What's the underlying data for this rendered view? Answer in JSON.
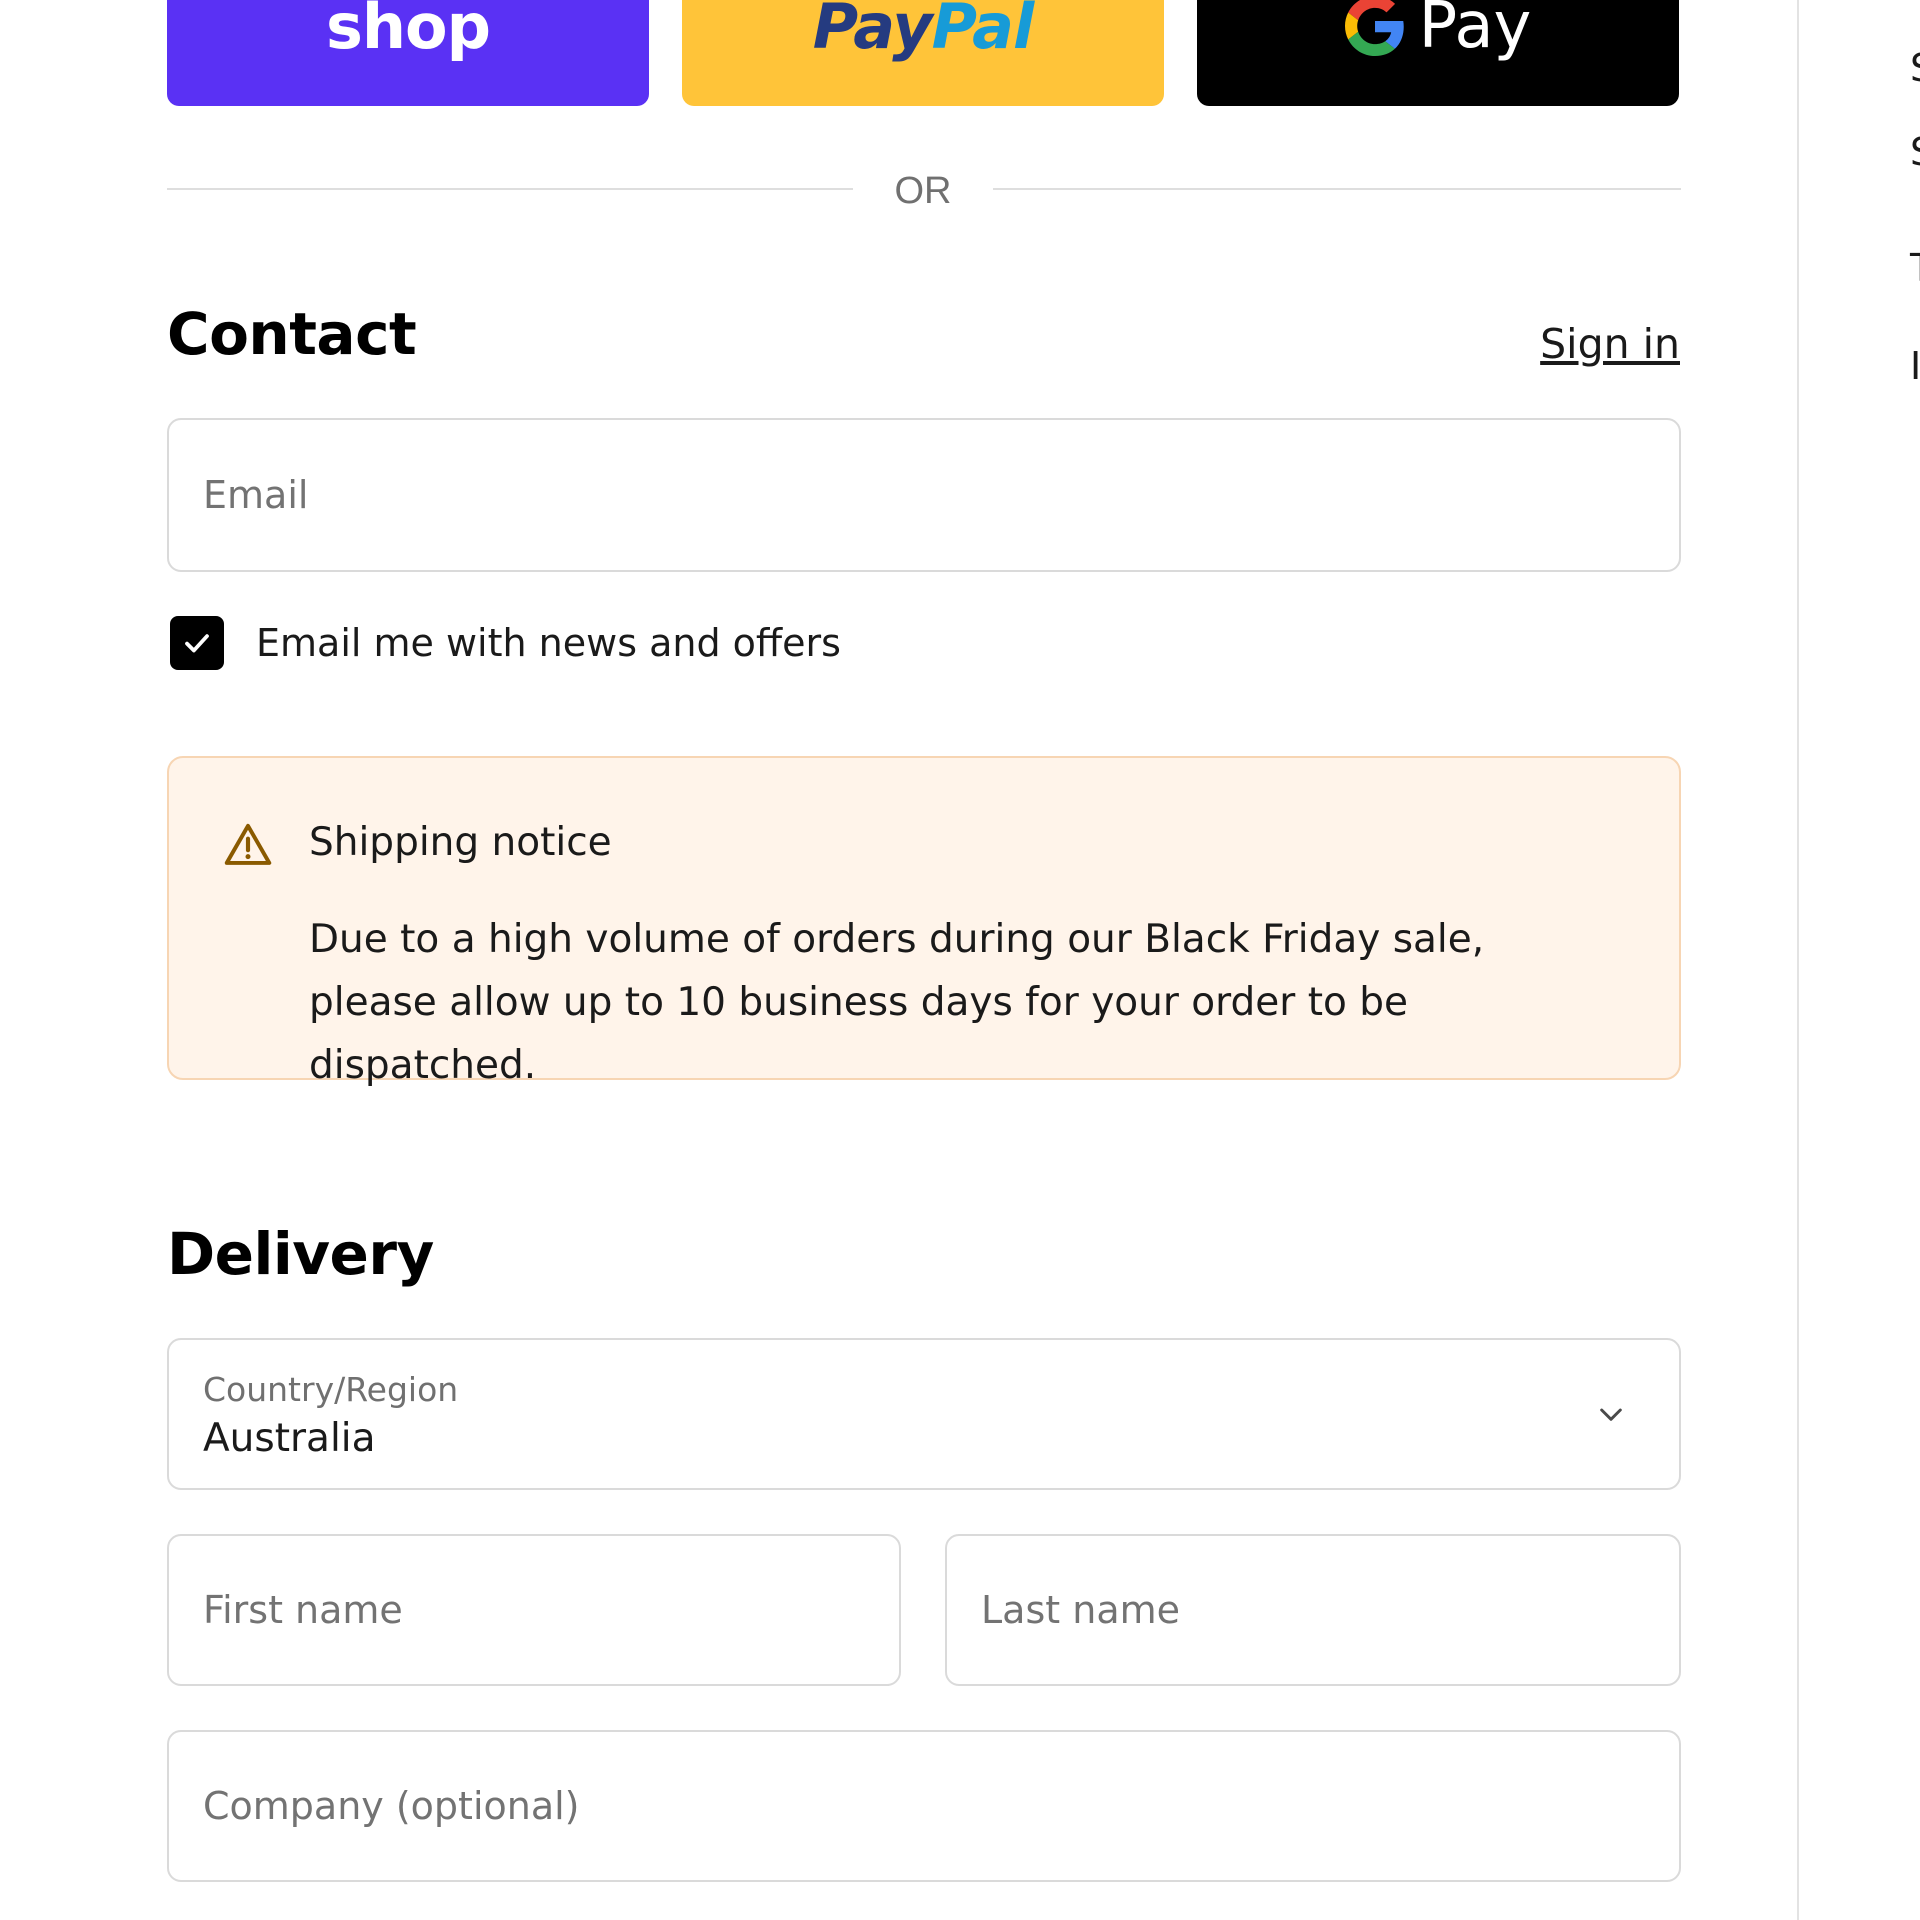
{
  "express_checkout": {
    "shop_label": "shop",
    "paypal_label_pay": "Pay",
    "paypal_label_pal": "Pal",
    "gpay_label": "Pay"
  },
  "divider": {
    "text": "OR"
  },
  "contact": {
    "title": "Contact",
    "sign_in": "Sign in",
    "email_placeholder": "Email",
    "email_value": "",
    "newsletter_label": "Email me with news and offers",
    "newsletter_checked": true
  },
  "notice": {
    "title": "Shipping notice",
    "body": "Due to a high volume of orders during our Black Friday sale, please allow up to 10 business days for your order to be dispatched."
  },
  "delivery": {
    "title": "Delivery",
    "country_label": "Country/Region",
    "country_value": "Australia",
    "first_name_placeholder": "First name",
    "last_name_placeholder": "Last name",
    "company_placeholder": "Company (optional)"
  },
  "colors": {
    "shop_purple": "#5a31f4",
    "paypal_yellow": "#ffc439",
    "gpay_black": "#000000",
    "notice_bg": "#fff4ea",
    "notice_border": "#f7d5b3",
    "warning_icon": "#8a5a00"
  },
  "icons": {
    "gpay": "google-g-icon",
    "notice": "warning-triangle-icon",
    "select": "chevron-down-icon",
    "checkbox": "checkmark-icon"
  }
}
